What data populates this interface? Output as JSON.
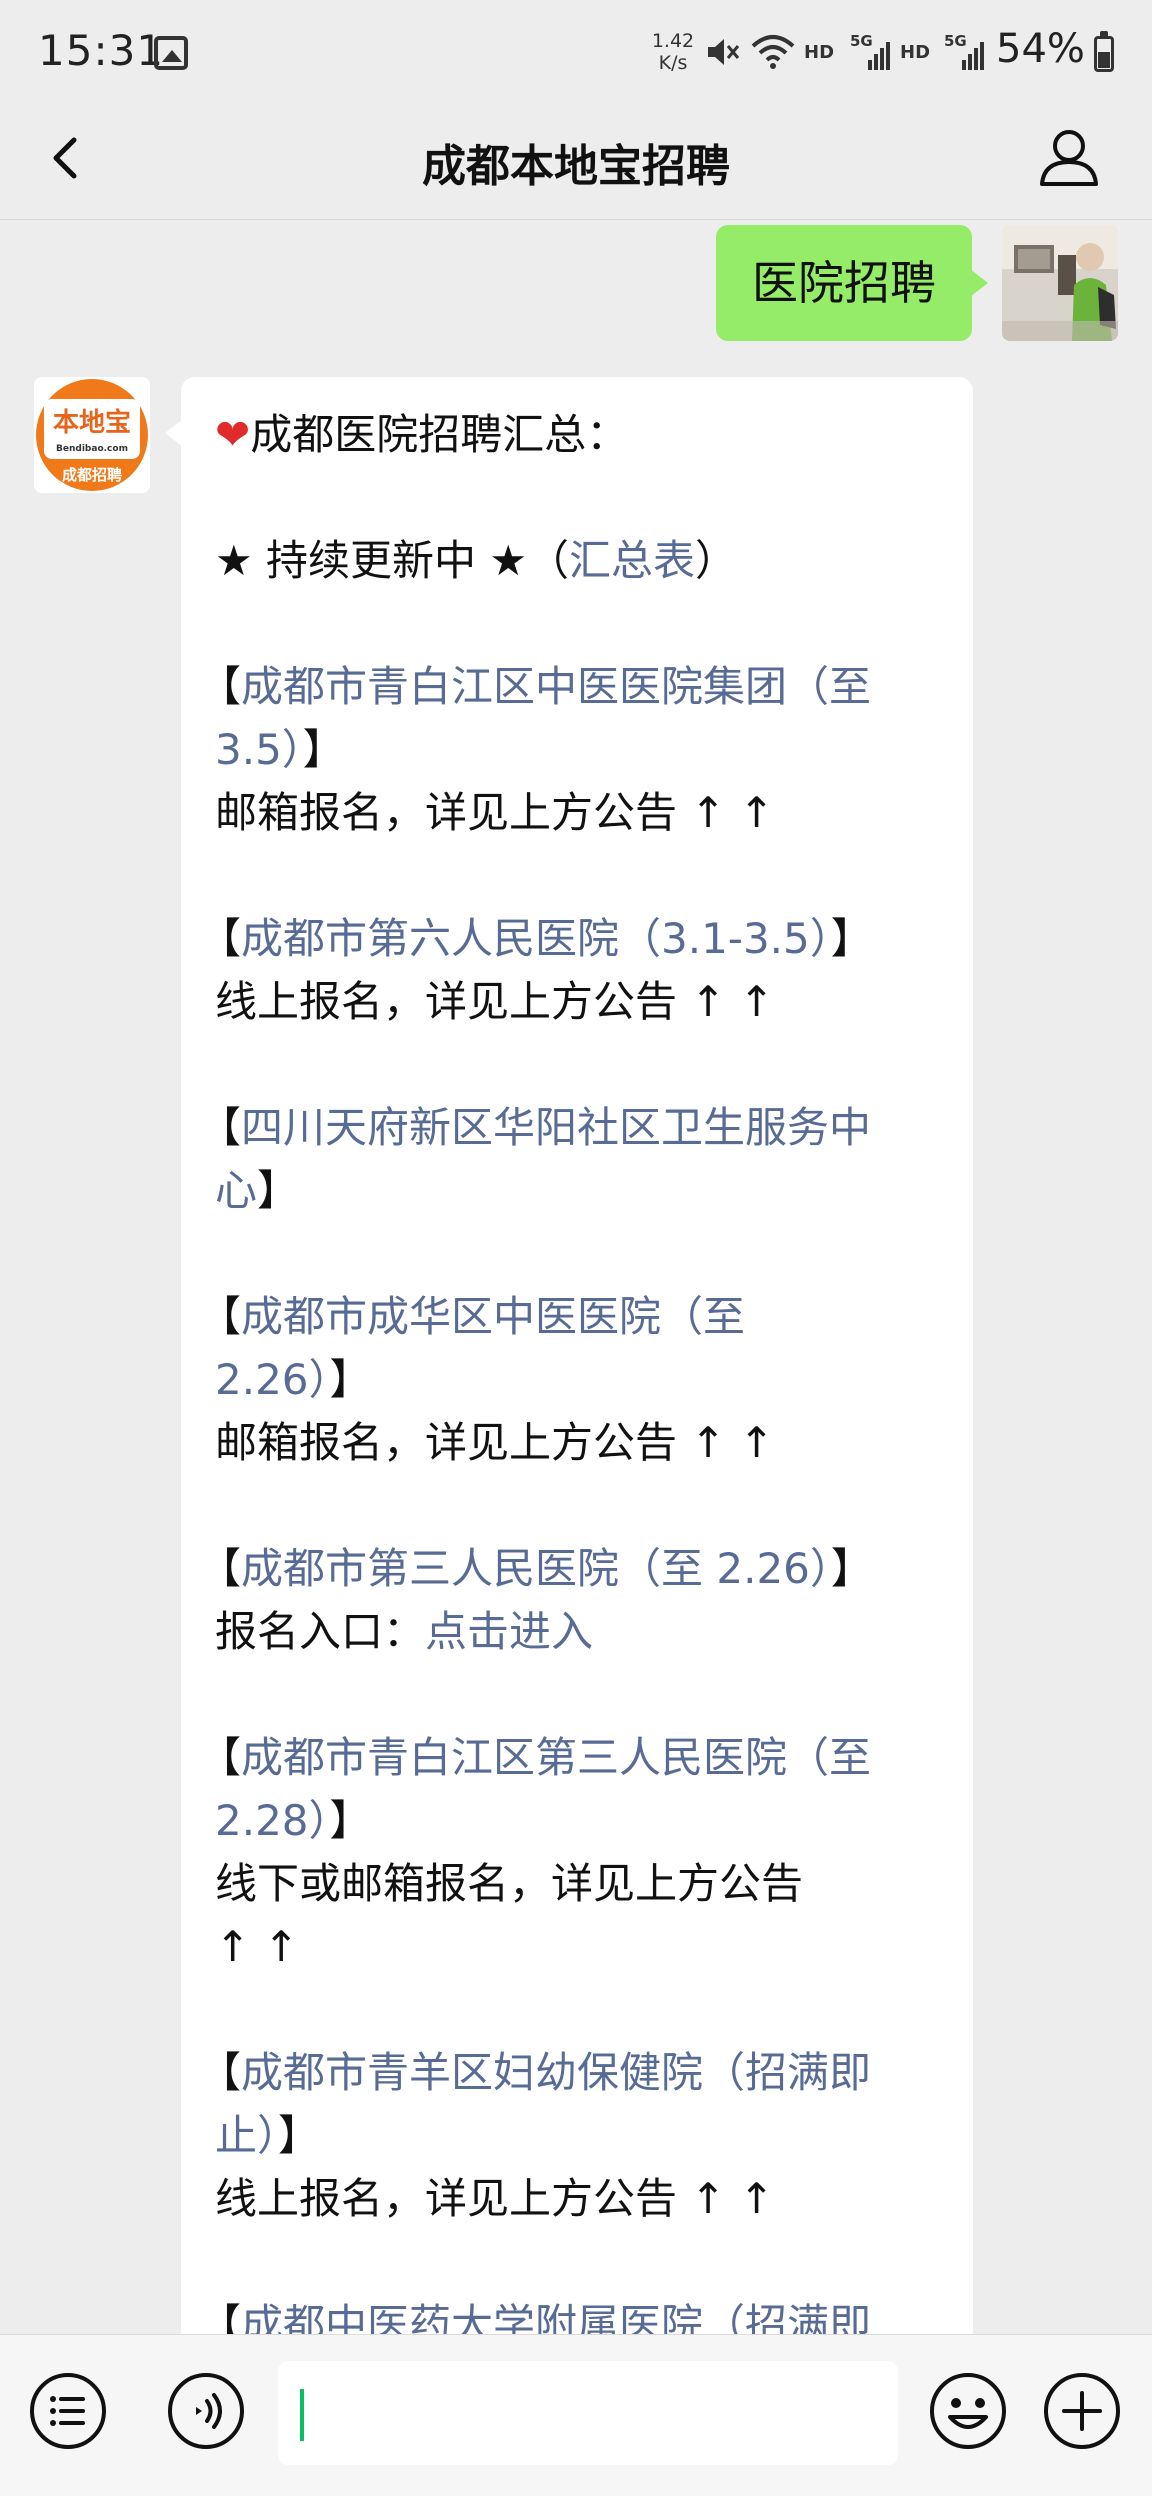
{
  "status_bar": {
    "time": "15:31",
    "speed": "1.42\nK/s",
    "hd1": "HD",
    "hd2": "HD",
    "net1": "5G",
    "net2": "5G",
    "battery": "54%",
    "battery_level": 0.54
  },
  "nav": {
    "title": "成都本地宝招聘"
  },
  "messages": {
    "me_text": "医院招聘",
    "bot_logo_top": "本地宝",
    "bot_logo_mid": "Bendibao.com",
    "bot_logo_bottom": "成都招聘",
    "bot": {
      "title": "成都医院招聘汇总：",
      "updating_prefix": "★ 持续更新中 ★（",
      "updating_link": "汇总表",
      "updating_suffix": "）",
      "item1_link_a": "成都市青白江区中医医院集团（至",
      "item1_link_b": "3.5）",
      "item1_note": "邮箱报名，详见上方公告 ↑ ↑",
      "item2_link": "成都市第六人民医院（3.1-3.5）",
      "item2_note": "线上报名，详见上方公告 ↑ ↑",
      "item3_link_a": "四川天府新区华阳社区卫生服务中",
      "item3_link_b": "心",
      "item4_link_a": "成都市成华区中医医院（至",
      "item4_link_b": "2.26）",
      "item4_note": "邮箱报名，详见上方公告 ↑ ↑",
      "item5_link": "成都市第三人民医院（至 2.26）",
      "item5_note_prefix": "报名入口：",
      "item5_note_link": "点击进入",
      "item6_link_a": "成都市青白江区第三人民医院（至",
      "item6_link_b": "2.28）",
      "item6_note_a": "线下或邮箱报名，详见上方公告",
      "item6_note_b": "↑ ↑",
      "item7_link_a": "成都市青羊区妇幼保健院（招满即",
      "item7_link_b": "止）",
      "item7_note": "线上报名，详见上方公告 ↑ ↑",
      "item8_link_a": "成都中医药大学附属医院（招满即"
    }
  },
  "bracket_open": "【",
  "bracket_close": "】",
  "icons": {
    "back": "chevron-left-icon",
    "profile": "person-icon",
    "list": "list-icon",
    "voice": "voice-icon",
    "emoji": "emoji-icon",
    "plus": "plus-icon"
  },
  "colors": {
    "link": "#576b95",
    "my_bubble": "#95ec69",
    "background": "#ededed",
    "caret": "#07c160",
    "logo_orange": "#f07a1a"
  }
}
